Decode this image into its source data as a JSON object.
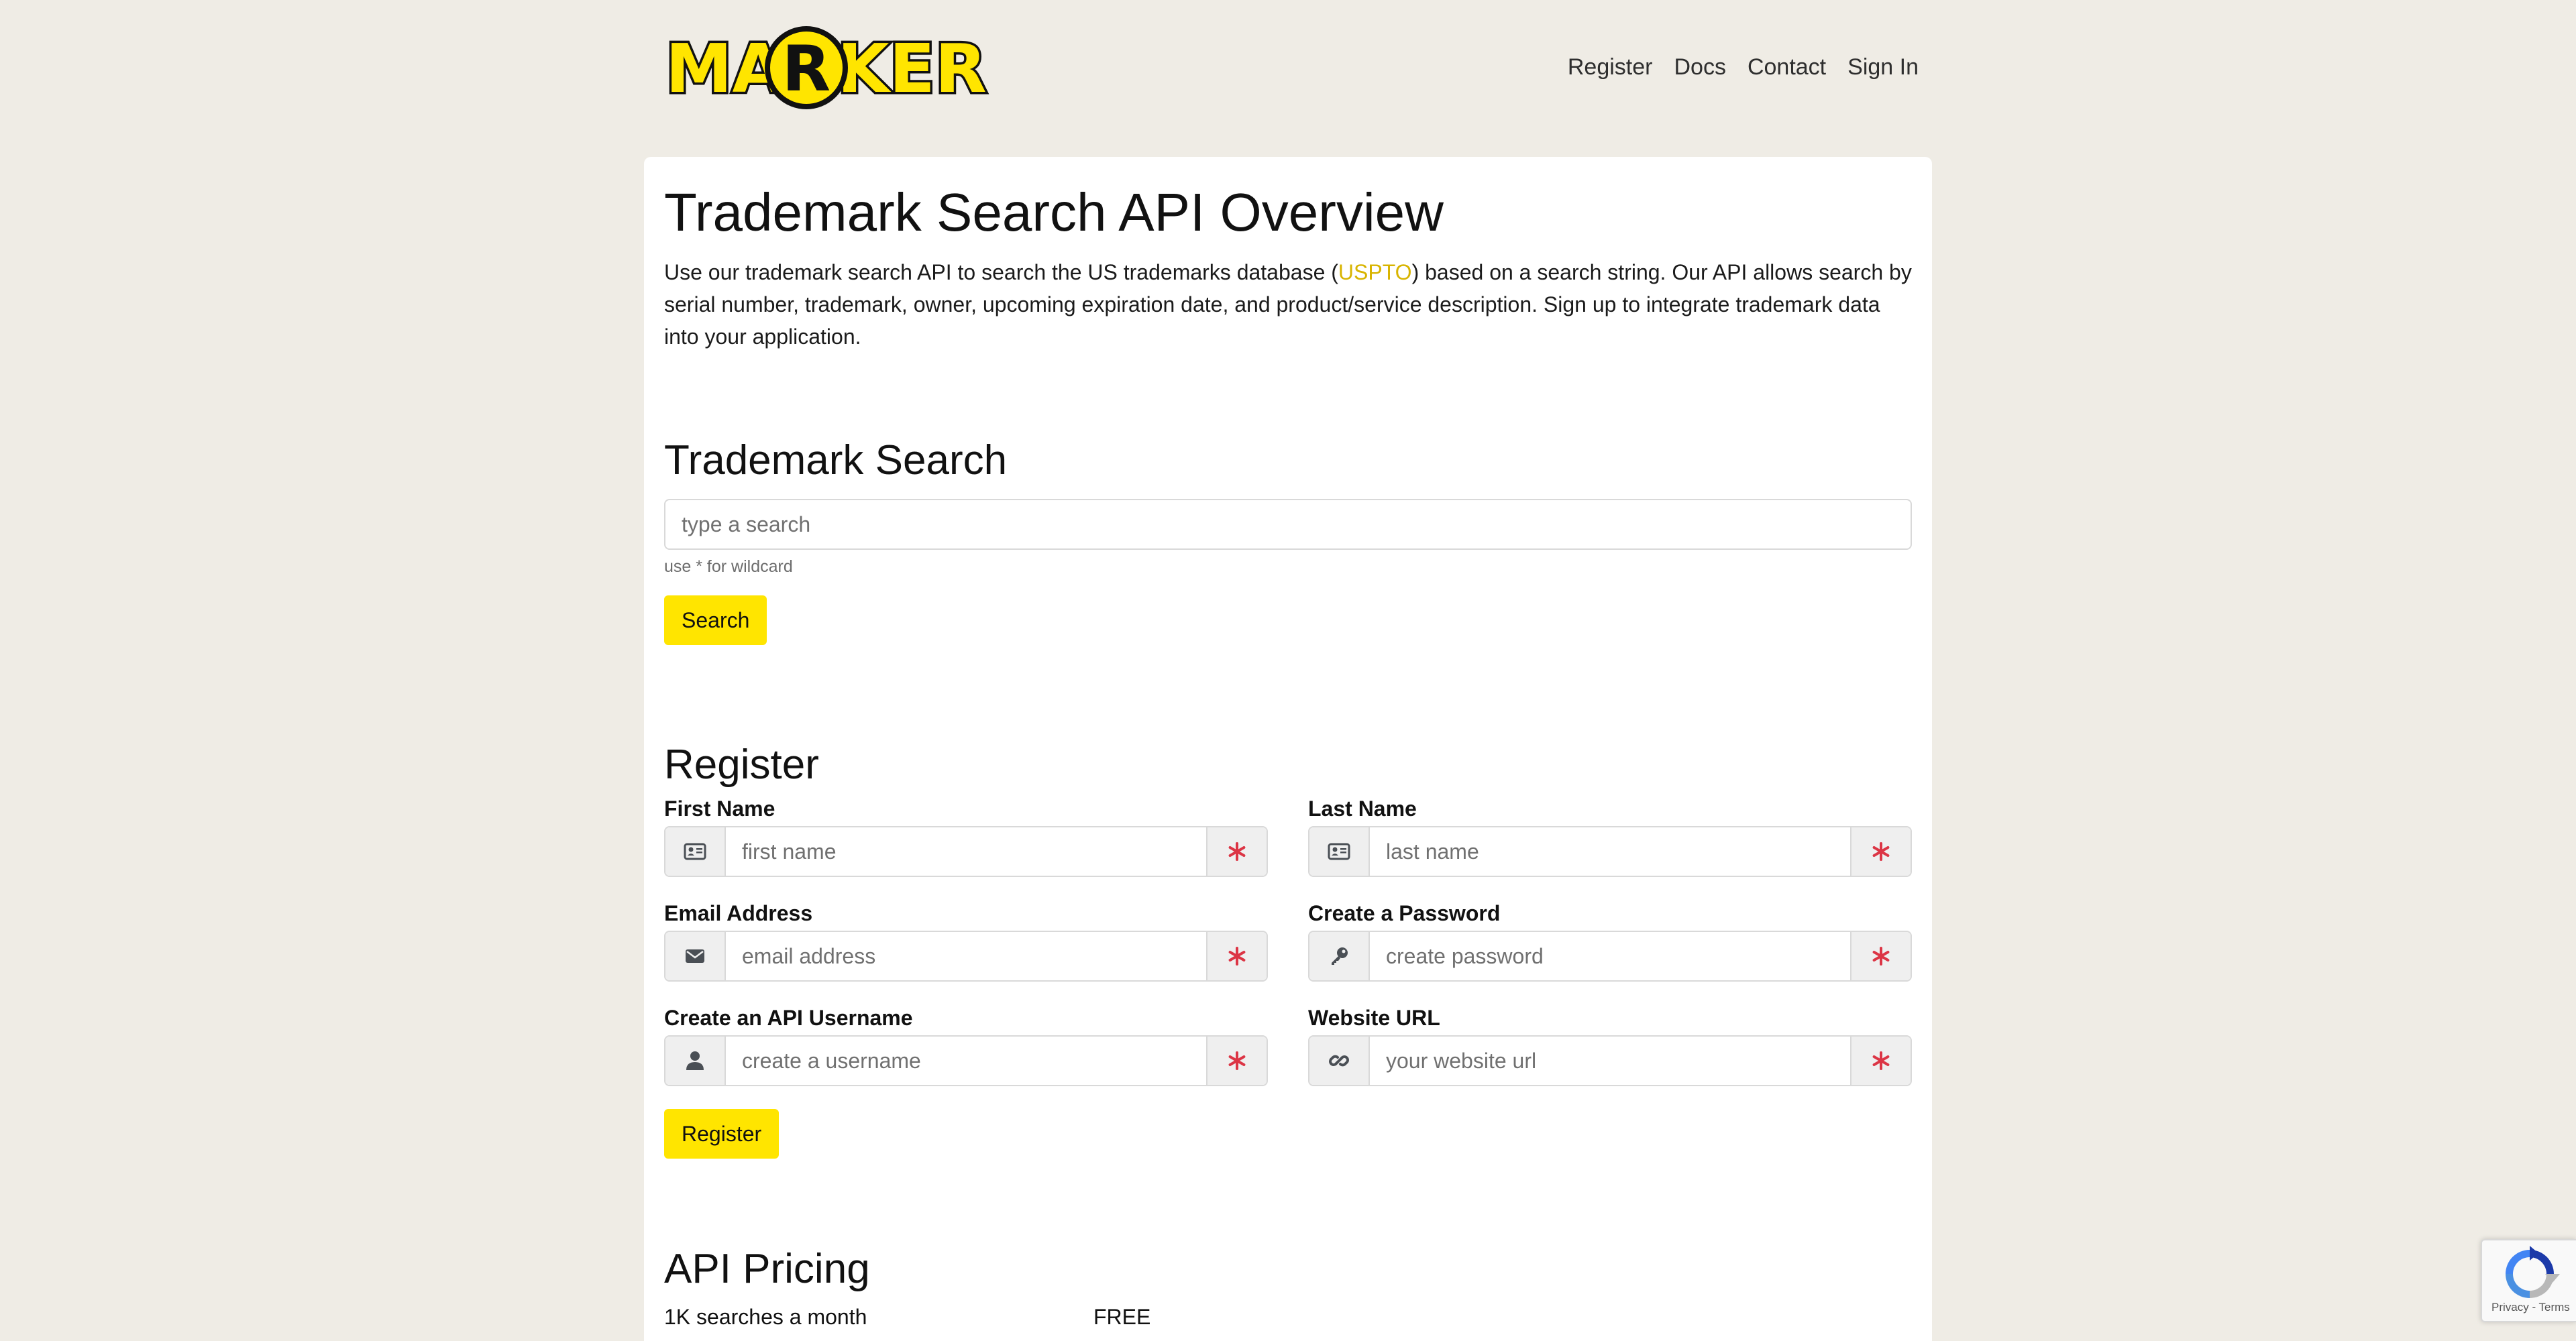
{
  "header": {
    "logo_text": "MARKER",
    "nav": [
      {
        "label": "Register"
      },
      {
        "label": "Docs"
      },
      {
        "label": "Contact"
      },
      {
        "label": "Sign In"
      }
    ]
  },
  "overview": {
    "title": "Trademark Search API Overview",
    "intro_before": "Use our trademark search API to search the US trademarks database (",
    "intro_link": "USPTO",
    "intro_after": ") based on a search string. Our API allows search by serial number, trademark, owner, upcoming expiration date, and product/service description. Sign up to integrate trademark data into your application."
  },
  "search": {
    "heading": "Trademark Search",
    "placeholder": "type a search",
    "helper": "use * for wildcard",
    "button_label": "Search"
  },
  "register": {
    "heading": "Register",
    "fields": [
      {
        "label": "First Name",
        "placeholder": "first name",
        "icon": "id-card-icon"
      },
      {
        "label": "Last Name",
        "placeholder": "last name",
        "icon": "id-card-icon"
      },
      {
        "label": "Email Address",
        "placeholder": "email address",
        "icon": "envelope-icon"
      },
      {
        "label": "Create a Password",
        "placeholder": "create password",
        "icon": "key-icon"
      },
      {
        "label": "Create an API Username",
        "placeholder": "create a username",
        "icon": "user-icon"
      },
      {
        "label": "Website URL",
        "placeholder": "your website url",
        "icon": "link-icon"
      }
    ],
    "required_icon": "asterisk-icon",
    "button_label": "Register"
  },
  "pricing": {
    "heading": "API Pricing",
    "rows": [
      {
        "tier": "1K searches a month",
        "price": "FREE"
      }
    ]
  },
  "recaptcha": {
    "terms": "Privacy - Terms"
  },
  "colors": {
    "background": "#efece5",
    "accent_yellow": "#ffe500",
    "required_red": "#dc3545",
    "link_gold": "#d8b400"
  }
}
